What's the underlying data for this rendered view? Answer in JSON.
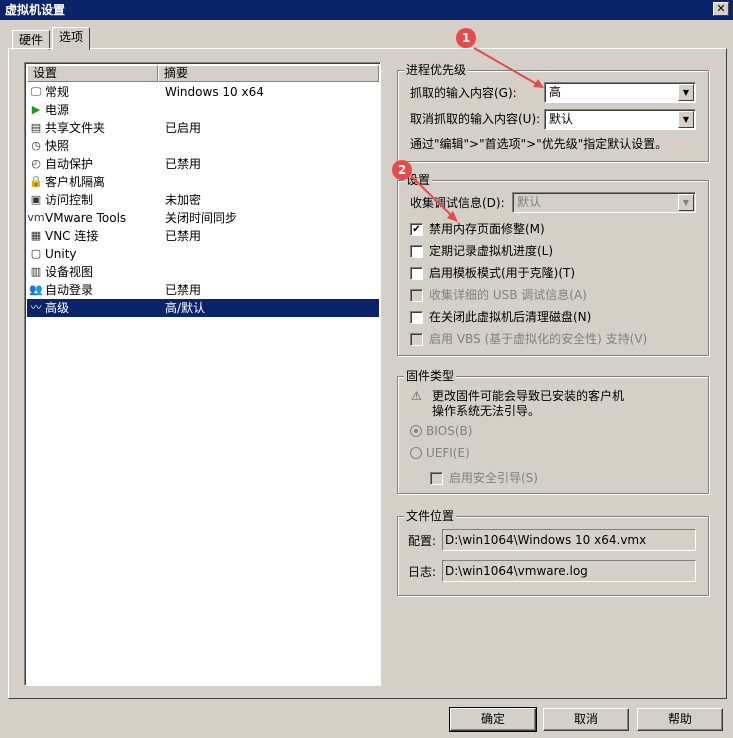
{
  "window": {
    "title": "虚拟机设置",
    "close": "✕"
  },
  "tabs": [
    {
      "label": "硬件"
    },
    {
      "label": "选项"
    }
  ],
  "list": {
    "headers": [
      "设置",
      "摘要"
    ],
    "rows": [
      {
        "icon": "monitor-icon",
        "glyph": "🖵",
        "name": "常规",
        "summary": "Windows 10 x64"
      },
      {
        "icon": "power-icon",
        "glyph": "▶",
        "name": "电源",
        "summary": ""
      },
      {
        "icon": "shared-folder-icon",
        "glyph": "▤",
        "name": "共享文件夹",
        "summary": "已启用"
      },
      {
        "icon": "snapshot-icon",
        "glyph": "◷",
        "name": "快照",
        "summary": ""
      },
      {
        "icon": "autoprotect-icon",
        "glyph": "◴",
        "name": "自动保护",
        "summary": "已禁用"
      },
      {
        "icon": "lock-icon",
        "glyph": "🔒",
        "name": "客户机隔离",
        "summary": ""
      },
      {
        "icon": "access-control-icon",
        "glyph": "▣",
        "name": "访问控制",
        "summary": "未加密"
      },
      {
        "icon": "vmware-tools-icon",
        "glyph": "vm",
        "name": "VMware Tools",
        "summary": "关闭时间同步"
      },
      {
        "icon": "vnc-icon",
        "glyph": "▦",
        "name": "VNC 连接",
        "summary": "已禁用"
      },
      {
        "icon": "unity-icon",
        "glyph": "▢",
        "name": "Unity",
        "summary": ""
      },
      {
        "icon": "device-view-icon",
        "glyph": "▥",
        "name": "设备视图",
        "summary": ""
      },
      {
        "icon": "autologin-icon",
        "glyph": "👥",
        "name": "自动登录",
        "summary": "已禁用"
      },
      {
        "icon": "advanced-icon",
        "glyph": "〰",
        "name": "高级",
        "summary": "高/默认"
      }
    ],
    "selected": 12
  },
  "priority": {
    "title": "进程优先级",
    "grab_label": "抓取的输入内容(G):",
    "grab_value": "高",
    "ungrab_label": "取消抓取的输入内容(U):",
    "ungrab_value": "默认",
    "note": "通过\"编辑\">\"首选项\">\"优先级\"指定默认设置。"
  },
  "settings": {
    "title": "设置",
    "debug_label": "收集调试信息(D):",
    "debug_value": "默认",
    "checkboxes": [
      {
        "label": "禁用内存页面修整(M)",
        "checked": true,
        "enabled": true
      },
      {
        "label": "定期记录虚拟机进度(L)",
        "checked": false,
        "enabled": true
      },
      {
        "label": "启用模板模式(用于克隆)(T)",
        "checked": false,
        "enabled": true
      },
      {
        "label": "收集详细的 USB 调试信息(A)",
        "checked": false,
        "enabled": false
      },
      {
        "label": "在关闭此虚拟机后清理磁盘(N)",
        "checked": false,
        "enabled": true
      },
      {
        "label": "启用 VBS (基于虚拟化的安全性) 支持(V)",
        "checked": false,
        "enabled": false
      }
    ]
  },
  "firmware": {
    "title": "固件类型",
    "warning_line1": "更改固件可能会导致已安装的客户机",
    "warning_line2": "操作系统无法引导。",
    "bios": "BIOS(B)",
    "uefi": "UEFI(E)",
    "secure_boot": "启用安全引导(S)"
  },
  "file_location": {
    "title": "文件位置",
    "config_label": "配置:",
    "config_value": "D:\\win1064\\Windows 10 x64.vmx",
    "log_label": "日志:",
    "log_value": "D:\\win1064\\vmware.log"
  },
  "buttons": {
    "ok": "确定",
    "cancel": "取消",
    "help": "帮助"
  },
  "annotations": {
    "one": "1",
    "two": "2",
    "color": "#e84a4a"
  }
}
